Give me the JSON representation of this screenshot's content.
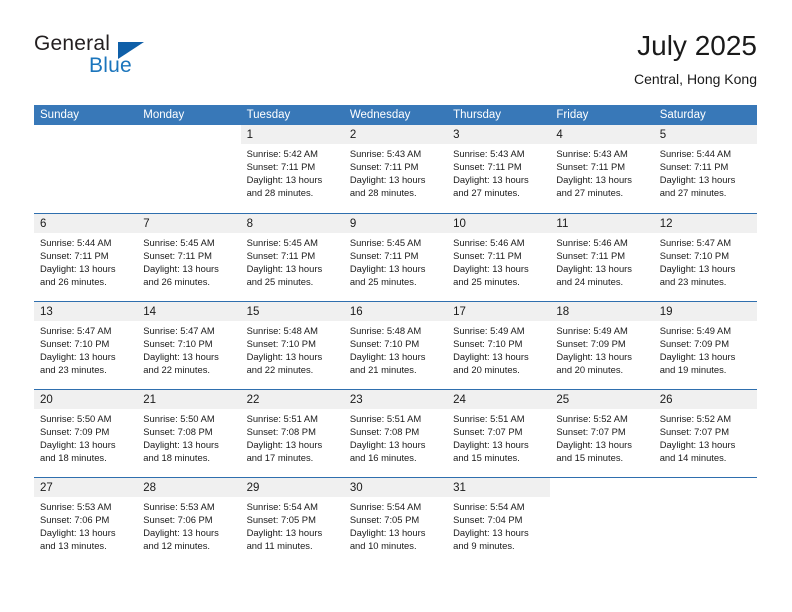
{
  "brand": {
    "word1": "General",
    "word2": "Blue",
    "triangle_color": "#0f5fa8",
    "blue_color": "#1b75bc"
  },
  "header": {
    "title": "July 2025",
    "subtitle": "Central, Hong Kong"
  },
  "theme": {
    "header_blue": "#3878b8",
    "divider_blue": "#2f6fae",
    "daynum_band": "#f0f0f0"
  },
  "calendar": {
    "weekday_headers": [
      "Sunday",
      "Monday",
      "Tuesday",
      "Wednesday",
      "Thursday",
      "Friday",
      "Saturday"
    ],
    "weeks": [
      [
        {
          "day": "",
          "lines": []
        },
        {
          "day": "",
          "lines": []
        },
        {
          "day": "1",
          "lines": [
            "Sunrise: 5:42 AM",
            "Sunset: 7:11 PM",
            "Daylight: 13 hours",
            "and 28 minutes."
          ]
        },
        {
          "day": "2",
          "lines": [
            "Sunrise: 5:43 AM",
            "Sunset: 7:11 PM",
            "Daylight: 13 hours",
            "and 28 minutes."
          ]
        },
        {
          "day": "3",
          "lines": [
            "Sunrise: 5:43 AM",
            "Sunset: 7:11 PM",
            "Daylight: 13 hours",
            "and 27 minutes."
          ]
        },
        {
          "day": "4",
          "lines": [
            "Sunrise: 5:43 AM",
            "Sunset: 7:11 PM",
            "Daylight: 13 hours",
            "and 27 minutes."
          ]
        },
        {
          "day": "5",
          "lines": [
            "Sunrise: 5:44 AM",
            "Sunset: 7:11 PM",
            "Daylight: 13 hours",
            "and 27 minutes."
          ]
        }
      ],
      [
        {
          "day": "6",
          "lines": [
            "Sunrise: 5:44 AM",
            "Sunset: 7:11 PM",
            "Daylight: 13 hours",
            "and 26 minutes."
          ]
        },
        {
          "day": "7",
          "lines": [
            "Sunrise: 5:45 AM",
            "Sunset: 7:11 PM",
            "Daylight: 13 hours",
            "and 26 minutes."
          ]
        },
        {
          "day": "8",
          "lines": [
            "Sunrise: 5:45 AM",
            "Sunset: 7:11 PM",
            "Daylight: 13 hours",
            "and 25 minutes."
          ]
        },
        {
          "day": "9",
          "lines": [
            "Sunrise: 5:45 AM",
            "Sunset: 7:11 PM",
            "Daylight: 13 hours",
            "and 25 minutes."
          ]
        },
        {
          "day": "10",
          "lines": [
            "Sunrise: 5:46 AM",
            "Sunset: 7:11 PM",
            "Daylight: 13 hours",
            "and 25 minutes."
          ]
        },
        {
          "day": "11",
          "lines": [
            "Sunrise: 5:46 AM",
            "Sunset: 7:11 PM",
            "Daylight: 13 hours",
            "and 24 minutes."
          ]
        },
        {
          "day": "12",
          "lines": [
            "Sunrise: 5:47 AM",
            "Sunset: 7:10 PM",
            "Daylight: 13 hours",
            "and 23 minutes."
          ]
        }
      ],
      [
        {
          "day": "13",
          "lines": [
            "Sunrise: 5:47 AM",
            "Sunset: 7:10 PM",
            "Daylight: 13 hours",
            "and 23 minutes."
          ]
        },
        {
          "day": "14",
          "lines": [
            "Sunrise: 5:47 AM",
            "Sunset: 7:10 PM",
            "Daylight: 13 hours",
            "and 22 minutes."
          ]
        },
        {
          "day": "15",
          "lines": [
            "Sunrise: 5:48 AM",
            "Sunset: 7:10 PM",
            "Daylight: 13 hours",
            "and 22 minutes."
          ]
        },
        {
          "day": "16",
          "lines": [
            "Sunrise: 5:48 AM",
            "Sunset: 7:10 PM",
            "Daylight: 13 hours",
            "and 21 minutes."
          ]
        },
        {
          "day": "17",
          "lines": [
            "Sunrise: 5:49 AM",
            "Sunset: 7:10 PM",
            "Daylight: 13 hours",
            "and 20 minutes."
          ]
        },
        {
          "day": "18",
          "lines": [
            "Sunrise: 5:49 AM",
            "Sunset: 7:09 PM",
            "Daylight: 13 hours",
            "and 20 minutes."
          ]
        },
        {
          "day": "19",
          "lines": [
            "Sunrise: 5:49 AM",
            "Sunset: 7:09 PM",
            "Daylight: 13 hours",
            "and 19 minutes."
          ]
        }
      ],
      [
        {
          "day": "20",
          "lines": [
            "Sunrise: 5:50 AM",
            "Sunset: 7:09 PM",
            "Daylight: 13 hours",
            "and 18 minutes."
          ]
        },
        {
          "day": "21",
          "lines": [
            "Sunrise: 5:50 AM",
            "Sunset: 7:08 PM",
            "Daylight: 13 hours",
            "and 18 minutes."
          ]
        },
        {
          "day": "22",
          "lines": [
            "Sunrise: 5:51 AM",
            "Sunset: 7:08 PM",
            "Daylight: 13 hours",
            "and 17 minutes."
          ]
        },
        {
          "day": "23",
          "lines": [
            "Sunrise: 5:51 AM",
            "Sunset: 7:08 PM",
            "Daylight: 13 hours",
            "and 16 minutes."
          ]
        },
        {
          "day": "24",
          "lines": [
            "Sunrise: 5:51 AM",
            "Sunset: 7:07 PM",
            "Daylight: 13 hours",
            "and 15 minutes."
          ]
        },
        {
          "day": "25",
          "lines": [
            "Sunrise: 5:52 AM",
            "Sunset: 7:07 PM",
            "Daylight: 13 hours",
            "and 15 minutes."
          ]
        },
        {
          "day": "26",
          "lines": [
            "Sunrise: 5:52 AM",
            "Sunset: 7:07 PM",
            "Daylight: 13 hours",
            "and 14 minutes."
          ]
        }
      ],
      [
        {
          "day": "27",
          "lines": [
            "Sunrise: 5:53 AM",
            "Sunset: 7:06 PM",
            "Daylight: 13 hours",
            "and 13 minutes."
          ]
        },
        {
          "day": "28",
          "lines": [
            "Sunrise: 5:53 AM",
            "Sunset: 7:06 PM",
            "Daylight: 13 hours",
            "and 12 minutes."
          ]
        },
        {
          "day": "29",
          "lines": [
            "Sunrise: 5:54 AM",
            "Sunset: 7:05 PM",
            "Daylight: 13 hours",
            "and 11 minutes."
          ]
        },
        {
          "day": "30",
          "lines": [
            "Sunrise: 5:54 AM",
            "Sunset: 7:05 PM",
            "Daylight: 13 hours",
            "and 10 minutes."
          ]
        },
        {
          "day": "31",
          "lines": [
            "Sunrise: 5:54 AM",
            "Sunset: 7:04 PM",
            "Daylight: 13 hours",
            "and 9 minutes."
          ]
        },
        {
          "day": "",
          "lines": []
        },
        {
          "day": "",
          "lines": []
        }
      ]
    ]
  }
}
